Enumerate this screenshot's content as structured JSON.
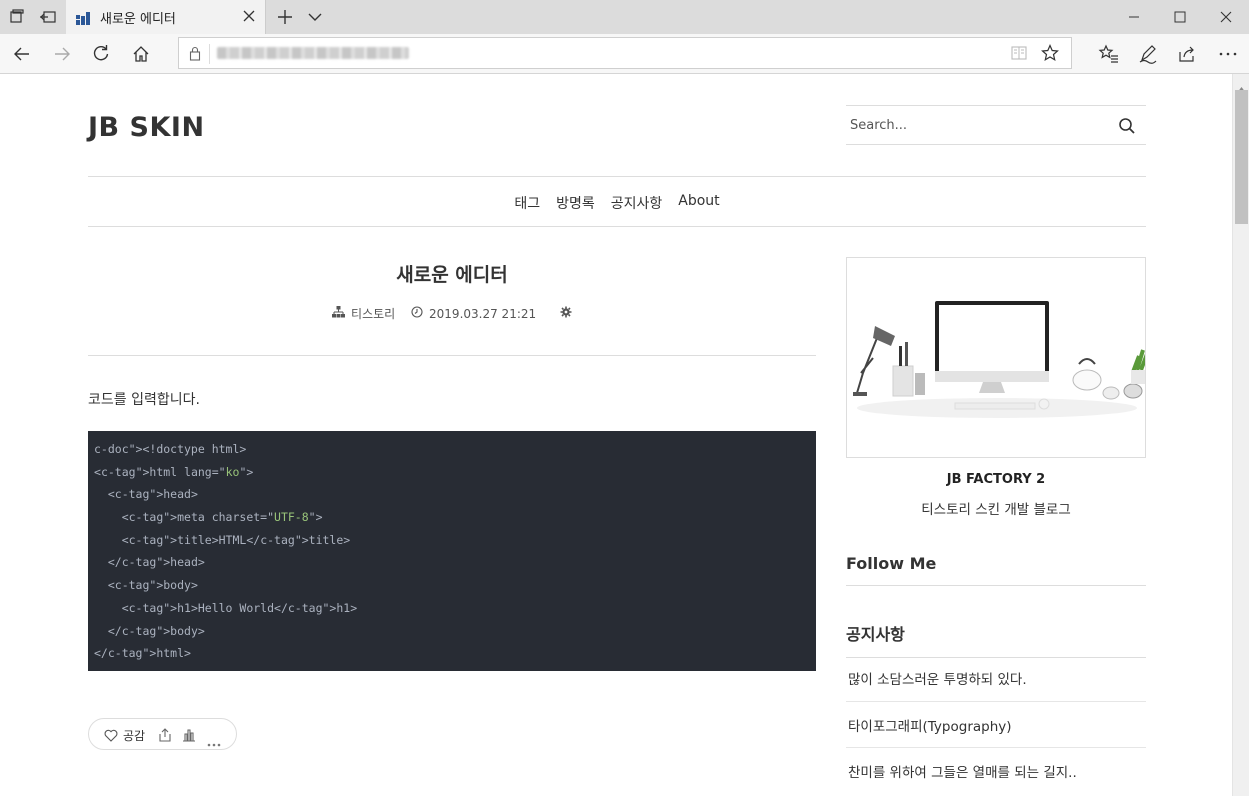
{
  "browser": {
    "tab_title": "새로운 에디터",
    "colors": {
      "titlebar": "#dcdcdc",
      "tab": "#f2f2f2",
      "navbar": "#f7f7f7"
    },
    "icons": [
      "tab-actions-icon",
      "set-aside-tabs-icon",
      "tab-favicon-icon",
      "tab-close-icon",
      "new-tab-icon",
      "tab-list-icon",
      "minimize-icon",
      "maximize-icon",
      "close-window-icon",
      "back-icon",
      "forward-icon",
      "refresh-icon",
      "home-icon",
      "lock-icon",
      "reading-view-icon",
      "favorite-star-icon",
      "favorites-hub-icon",
      "notes-pen-icon",
      "share-icon",
      "more-icon"
    ]
  },
  "blog": {
    "logo": "JB SKIN",
    "search_placeholder": "Search...",
    "menu": [
      "태그",
      "방명록",
      "공지사항",
      "About"
    ]
  },
  "post": {
    "title": "새로운 에디터",
    "category": "티스토리",
    "date": "2019.03.27 21:21",
    "text": "코드를 입력합니다.",
    "code_lines": [
      "<!doctype html>",
      "<html lang=\"ko\">",
      "  <head>",
      "    <meta charset=\"UTF-8\">",
      "    <title>HTML</title>",
      "  </head>",
      "  <body>",
      "    <h1>Hello World</h1>",
      "  </body>",
      "</html>"
    ],
    "like_label": "공감"
  },
  "sidebar": {
    "profile_name": "JB FACTORY 2",
    "profile_desc": "티스토리 스킨 개발 블로그",
    "follow_title": "Follow Me",
    "notice_title": "공지사항",
    "notices": [
      "많이 소담스러운 투명하되 있다.",
      "타이포그래피(Typography)",
      "찬미를 위하여 그들은 열매를 되는 길지.."
    ]
  },
  "code_colors": {
    "background": "#282c34",
    "tag": "#e5c07b",
    "string": "#98c379",
    "text": "#abb2bf"
  }
}
